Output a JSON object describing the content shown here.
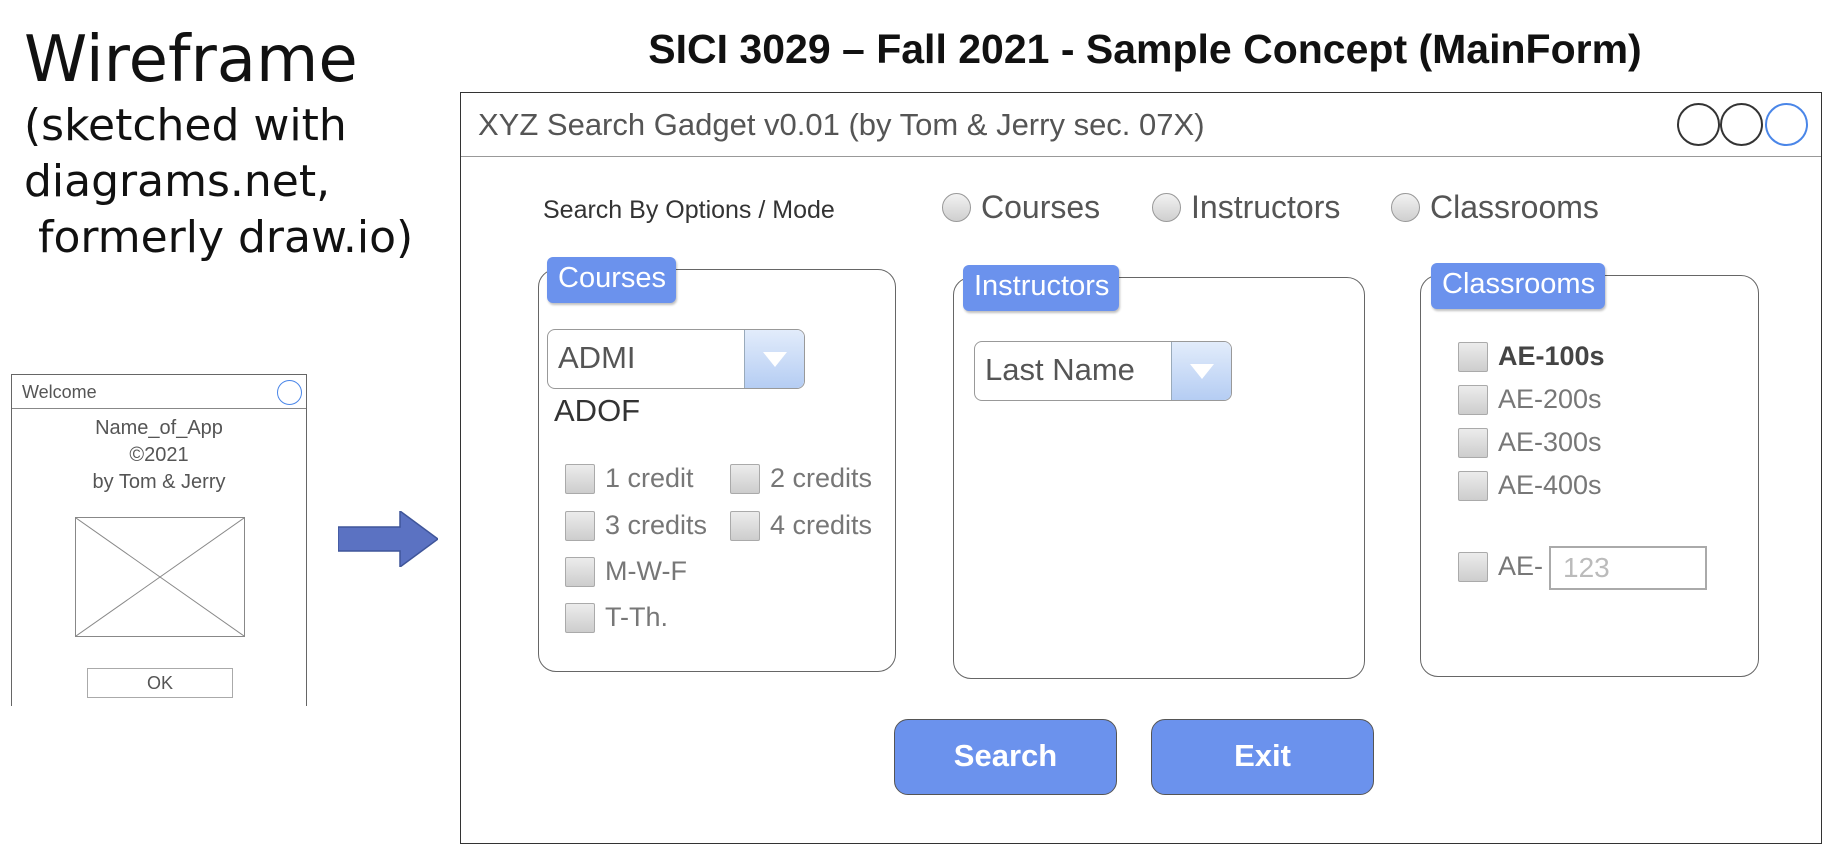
{
  "slide": {
    "title": "SICI 3029 – Fall 2021 - Sample Concept (MainForm)"
  },
  "caption": {
    "line1": "Wireframe",
    "line2": "(sketched with",
    "line3": "diagrams.net,",
    "line4": "formerly draw.io)"
  },
  "welcome": {
    "title": "Welcome",
    "app_name": "Name_of_App",
    "copyright": "©2021",
    "byline": "by Tom & Jerry",
    "ok_label": "OK"
  },
  "mainform": {
    "title": "XYZ Search Gadget v0.01 (by Tom & Jerry sec. 07X)",
    "search_by_label": "Search By Options / Mode",
    "modes": [
      "Courses",
      "Instructors",
      "Classrooms"
    ],
    "courses": {
      "header": "Courses",
      "dropdown_value": "ADMI",
      "next_option": "ADOF",
      "checkboxes": [
        "1 credit",
        "2 credits",
        "3 credits",
        "4 credits",
        "M-W-F",
        "T-Th."
      ]
    },
    "instructors": {
      "header": "Instructors",
      "dropdown_value": "Last Name"
    },
    "classrooms": {
      "header": "Classrooms",
      "checkboxes": [
        "AE-100s",
        "AE-200s",
        "AE-300s",
        "AE-400s"
      ],
      "custom_prefix": "AE-",
      "custom_placeholder": "123"
    },
    "search_label": "Search",
    "exit_label": "Exit"
  },
  "colors": {
    "accent": "#6b92ed",
    "close_circle": "#4a86e8"
  },
  "icons": {
    "arrow": "right-arrow-icon",
    "dropdown": "chevron-down-icon",
    "image_placeholder": "image-placeholder-icon"
  }
}
